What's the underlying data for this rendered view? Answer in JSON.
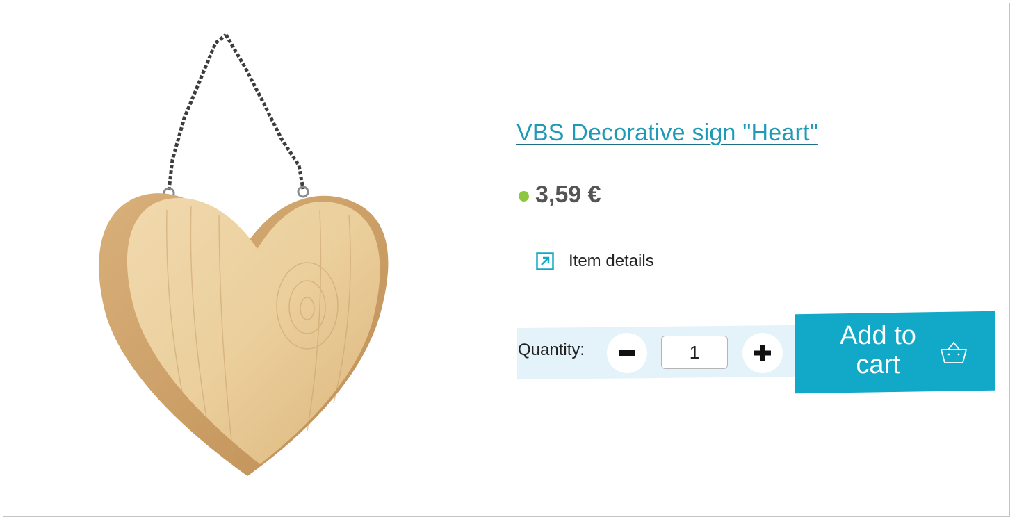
{
  "product": {
    "title": "VBS Decorative sign \"Heart\"",
    "price": "3,59 €",
    "stock_status_color": "#8dc63f",
    "details_link": "Item details",
    "details_icon": "arrow-up-right-box-icon"
  },
  "quantity": {
    "label": "Quantity:",
    "value": "1",
    "decrease_icon": "minus-icon",
    "increase_icon": "plus-icon"
  },
  "cart": {
    "label": "Add to cart",
    "icon": "shopping-basket-icon"
  },
  "colors": {
    "accent": "#12a8c8",
    "link": "#1e9ab7",
    "quantity_background": "#e3f3f9"
  }
}
